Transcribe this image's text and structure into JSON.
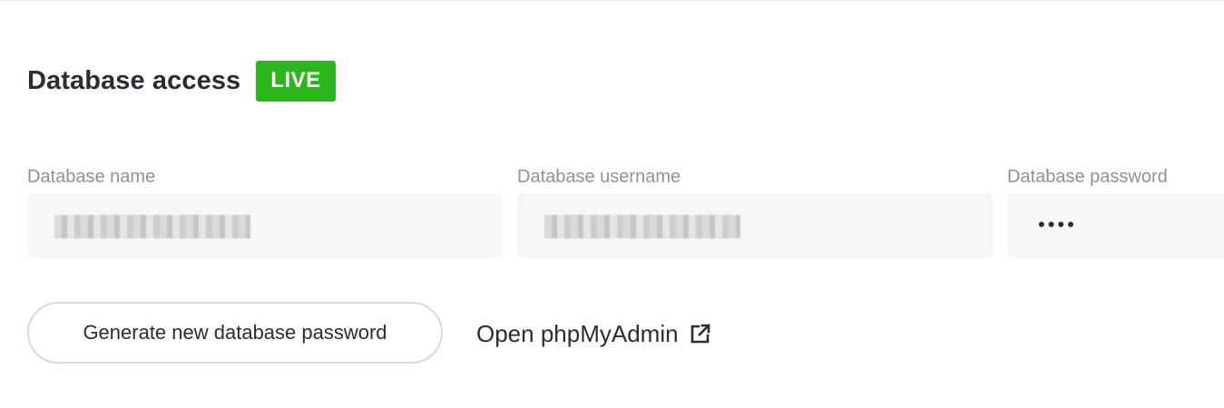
{
  "section": {
    "title": "Database access",
    "badge": "LIVE"
  },
  "fields": {
    "name": {
      "label": "Database name",
      "value_masked": true
    },
    "username": {
      "label": "Database username",
      "value_masked": true
    },
    "password": {
      "label": "Database password",
      "value": "••••"
    }
  },
  "actions": {
    "generate_password": "Generate new database password",
    "open_phpmyadmin": "Open phpMyAdmin",
    "open_phpmyadmin_icon": "external-link-icon"
  },
  "colors": {
    "live_badge": "#2db51d",
    "field_bg": "#f6f7f9",
    "label_text": "#8e929c",
    "primary_text": "#2b2c35"
  }
}
